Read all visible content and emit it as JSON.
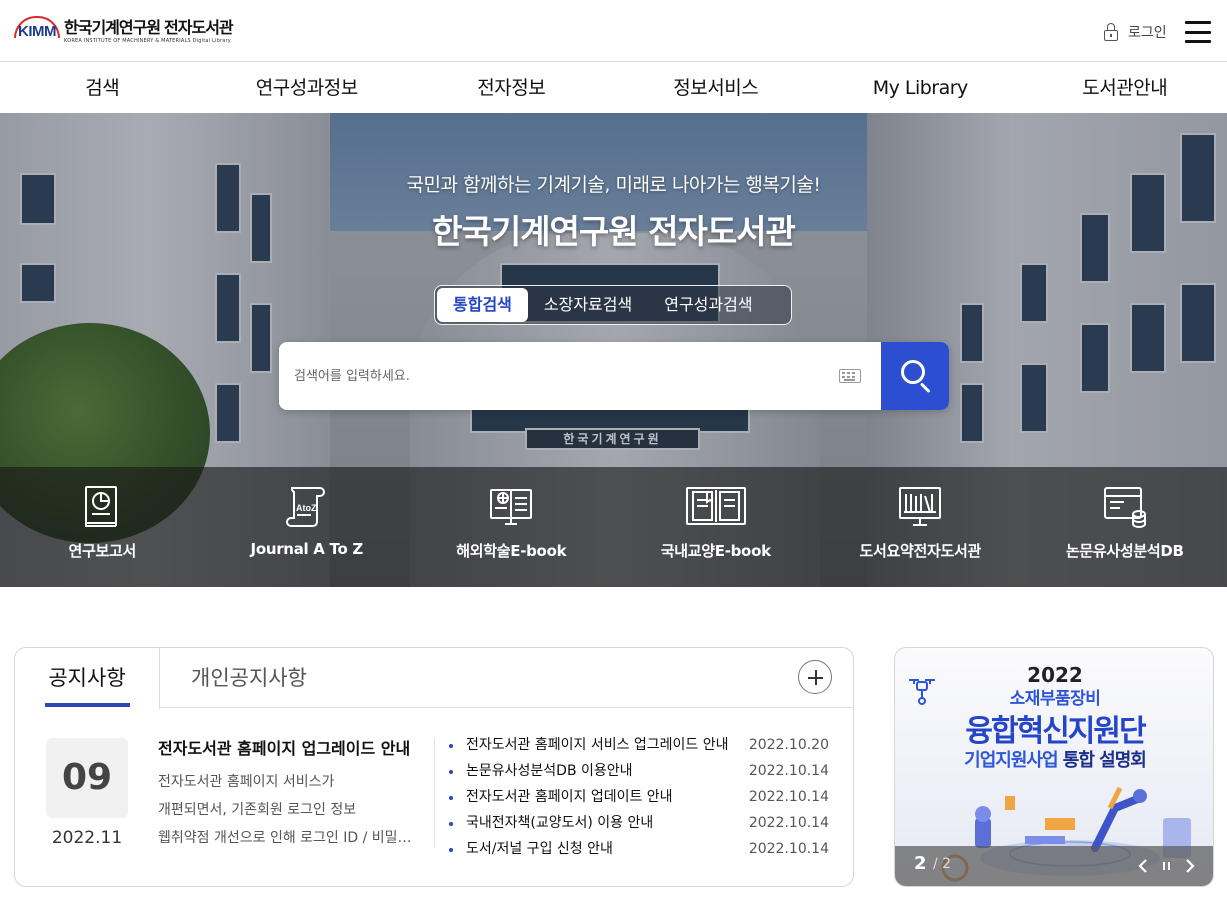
{
  "header": {
    "logo_mark": "KIMM",
    "logo_main": "한국기계연구원",
    "logo_sub": "전자도서관",
    "logo_tiny": "KOREA INSTITUTE OF MACHINERY & MATERIALS   Digital Library",
    "login_label": "로그인"
  },
  "nav": [
    "검색",
    "연구성과정보",
    "전자정보",
    "정보서비스",
    "My Library",
    "도서관안내"
  ],
  "hero": {
    "subtitle": "국민과 함께하는 기계기술, 미래로 나아가는 행복기술!",
    "title": "한국기계연구원 전자도서관",
    "sign": "한국기계연구원",
    "tabs": [
      "통합검색",
      "소장자료검색",
      "연구성과검색"
    ],
    "active_tab": "통합검색",
    "search_placeholder": "검색어를 입력하세요."
  },
  "quick_links": [
    {
      "label": "연구보고서",
      "icon": "report-book-icon"
    },
    {
      "label": "Journal A To Z",
      "icon": "scroll-atoz-icon",
      "icon_text": "AtoZ"
    },
    {
      "label": "해외학술E-book",
      "icon": "globe-ebook-icon"
    },
    {
      "label": "국내교양E-book",
      "icon": "open-book-icon"
    },
    {
      "label": "도서요약전자도서관",
      "icon": "bookshelf-monitor-icon"
    },
    {
      "label": "논문유사성분석DB",
      "icon": "database-icon"
    }
  ],
  "notice": {
    "tabs": [
      "공지사항",
      "개인공지사항"
    ],
    "active_tab": "공지사항",
    "featured": {
      "day": "09",
      "month": "2022.11",
      "title": "전자도서관 홈페이지 업그레이드 안내",
      "lines": [
        "전자도서관 홈페이지 서비스가",
        "개편되면서, 기존회원 로그인 정보",
        "웹취약점 개선으로 인해 로그인 ID / 비밀번호"
      ]
    },
    "items": [
      {
        "title": "전자도서관 홈페이지 서비스 업그레이드 안내",
        "date": "2022.10.20"
      },
      {
        "title": "논문유사성분석DB 이용안내",
        "date": "2022.10.14"
      },
      {
        "title": "전자도서관 홈페이지 업데이트 안내",
        "date": "2022.10.14"
      },
      {
        "title": "국내전자책(교양도서) 이용 안내",
        "date": "2022.10.14"
      },
      {
        "title": "도서/저널 구입 신청 안내",
        "date": "2022.10.14"
      }
    ]
  },
  "banner": {
    "year": "2022",
    "line1": "소재부품장비",
    "line2": "융합혁신지원단",
    "line3_a": "기업지원사업",
    "line3_b": " 통합 설명회",
    "page_current": "2",
    "page_total": "/ 2"
  },
  "colors": {
    "accent": "#2c4fd1",
    "notice_underline": "#3046b4",
    "logo_red": "#d62b2b",
    "logo_blue": "#1f3d8f"
  }
}
